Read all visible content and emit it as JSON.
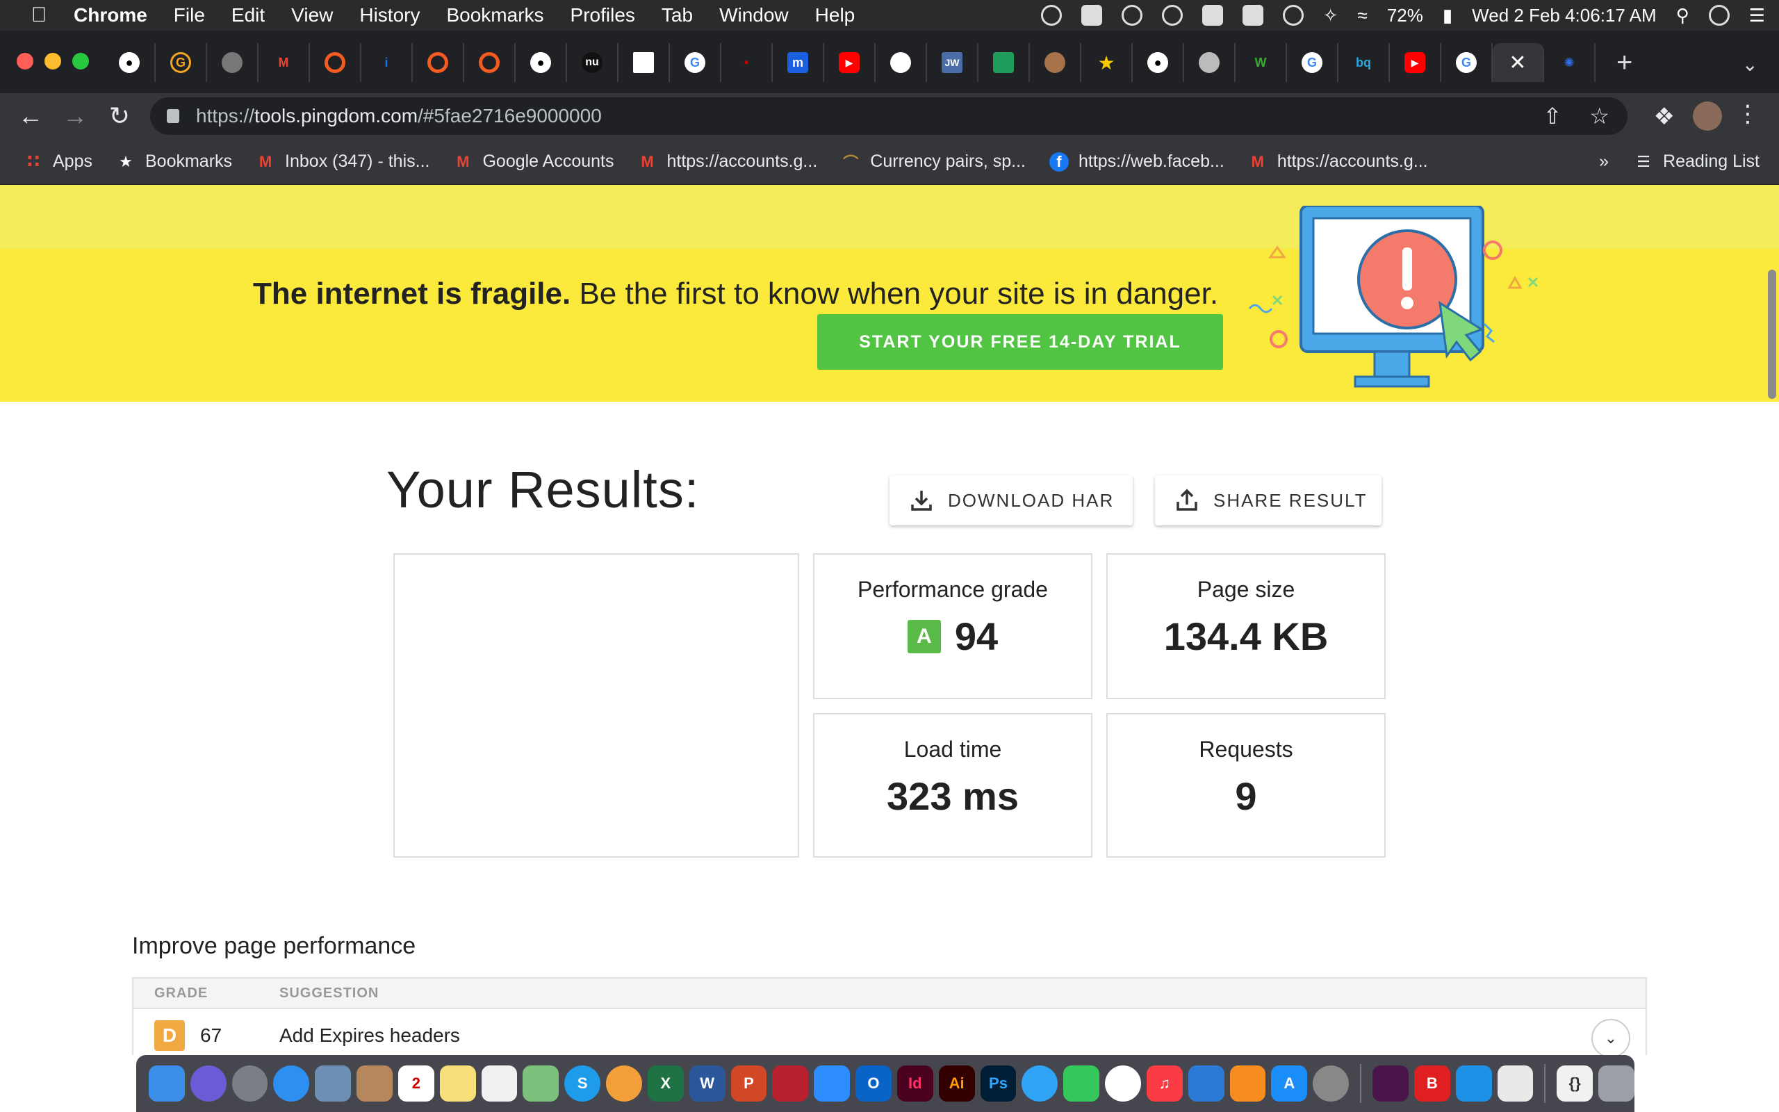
{
  "menubar": {
    "app_name": "Chrome",
    "items": [
      "File",
      "Edit",
      "View",
      "History",
      "Bookmarks",
      "Profiles",
      "Tab",
      "Window",
      "Help"
    ],
    "battery": "72%",
    "clock": "Wed 2 Feb  4:06:17 AM"
  },
  "browser": {
    "url_scheme": "https://",
    "url_host": "tools.pingdom.com",
    "url_rest": "/#5fae2716e9000000",
    "bookmarks": [
      {
        "label": "Apps",
        "icon": "apps-grid-icon"
      },
      {
        "label": "Bookmarks",
        "icon": "star-icon"
      },
      {
        "label": "Inbox (347) - this...",
        "icon": "gmail-icon"
      },
      {
        "label": "Google Accounts",
        "icon": "gmail-icon"
      },
      {
        "label": "https://accounts.g...",
        "icon": "gmail-icon"
      },
      {
        "label": "Currency pairs, sp...",
        "icon": "rainbow-icon"
      },
      {
        "label": "https://web.faceb...",
        "icon": "facebook-icon"
      },
      {
        "label": "https://accounts.g...",
        "icon": "gmail-icon"
      }
    ],
    "overflow": "»",
    "reading_list": "Reading List"
  },
  "banner": {
    "headline_bold": "The internet is fragile.",
    "headline_rest": " Be the first to know when your site is in danger.",
    "cta": "START YOUR FREE 14-DAY TRIAL"
  },
  "results": {
    "title": "Your Results:",
    "download_har": "DOWNLOAD HAR",
    "share_result": "SHARE RESULT",
    "metrics": {
      "performance_label": "Performance grade",
      "performance_grade": "A",
      "performance_value": "94",
      "page_size_label": "Page size",
      "page_size_value": "134.4 KB",
      "load_time_label": "Load time",
      "load_time_value": "323 ms",
      "requests_label": "Requests",
      "requests_value": "9"
    }
  },
  "improve": {
    "title": "Improve page performance",
    "col_grade": "GRADE",
    "col_suggestion": "SUGGESTION",
    "rows": [
      {
        "grade": "D",
        "score": "67",
        "suggestion": "Add Expires headers"
      }
    ]
  },
  "colors": {
    "banner_yellow": "#fbe93b",
    "cta_green": "#52c443",
    "grade_a_green": "#5aba47",
    "grade_d_orange": "#f0a841"
  }
}
